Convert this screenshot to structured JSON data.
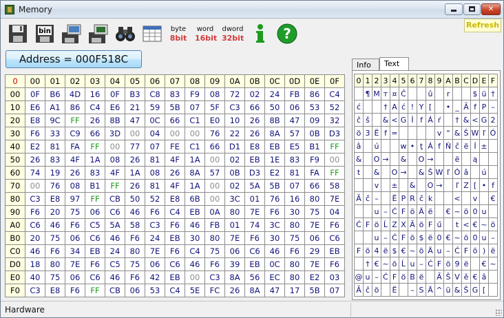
{
  "window": {
    "title": "Memory",
    "min_glyph": "",
    "max_glyph": "",
    "close_glyph": "✕"
  },
  "toolbar": {
    "buttons": [
      {
        "name": "save-icon"
      },
      {
        "name": "save-bin-icon",
        "label": "bin"
      },
      {
        "name": "save-computer-icon"
      },
      {
        "name": "save-chip-icon"
      },
      {
        "name": "find-binoculars-icon"
      },
      {
        "name": "calc-table-icon"
      },
      {
        "name": "byte-view",
        "top": "byte",
        "bottom": "8bit"
      },
      {
        "name": "word-view",
        "top": "word",
        "bottom": "16bit"
      },
      {
        "name": "dword-view",
        "top": "dword",
        "bottom": "32bit"
      },
      {
        "name": "info-icon",
        "glyph": "i"
      },
      {
        "name": "help-icon",
        "glyph": "?"
      }
    ],
    "refresh_label": "Refresh"
  },
  "address": {
    "label": "Address = 000F518C"
  },
  "hex": {
    "corner": "0",
    "cols": [
      "00",
      "01",
      "02",
      "03",
      "04",
      "05",
      "06",
      "07",
      "08",
      "09",
      "0A",
      "0B",
      "0C",
      "0D",
      "0E",
      "0F"
    ],
    "rows": [
      {
        "label": "00",
        "cells": [
          "0F",
          "B6",
          "4D",
          "16",
          "0F",
          "B3",
          "C8",
          "83",
          "F9",
          "08",
          "72",
          "02",
          "24",
          "FB",
          "86",
          "C4"
        ]
      },
      {
        "label": "10",
        "cells": [
          "E6",
          "A1",
          "86",
          "C4",
          "E6",
          "21",
          "59",
          "5B",
          "07",
          "5F",
          "C3",
          "66",
          "50",
          "06",
          "53",
          "52"
        ]
      },
      {
        "label": "20",
        "cells": [
          "E8",
          "9C",
          "FF",
          "26",
          "8B",
          "47",
          "0C",
          "66",
          "C1",
          "E0",
          "10",
          "26",
          "8B",
          "47",
          "09",
          "32"
        ]
      },
      {
        "label": "30",
        "cells": [
          "F6",
          "33",
          "C9",
          "66",
          "3D",
          "00",
          "04",
          "00",
          "00",
          "76",
          "22",
          "26",
          "8A",
          "57",
          "0B",
          "D3"
        ]
      },
      {
        "label": "40",
        "cells": [
          "E2",
          "81",
          "FA",
          "FF",
          "00",
          "77",
          "07",
          "FE",
          "C1",
          "66",
          "D1",
          "E8",
          "EB",
          "E5",
          "B1",
          "FF"
        ]
      },
      {
        "label": "50",
        "cells": [
          "26",
          "83",
          "4F",
          "1A",
          "08",
          "26",
          "81",
          "4F",
          "1A",
          "00",
          "02",
          "EB",
          "1E",
          "83",
          "F9",
          "00"
        ]
      },
      {
        "label": "60",
        "cells": [
          "74",
          "19",
          "26",
          "83",
          "4F",
          "1A",
          "08",
          "26",
          "8A",
          "57",
          "0B",
          "D3",
          "E2",
          "81",
          "FA",
          "FF"
        ]
      },
      {
        "label": "70",
        "cells": [
          "00",
          "76",
          "08",
          "B1",
          "FF",
          "26",
          "81",
          "4F",
          "1A",
          "00",
          "02",
          "5A",
          "5B",
          "07",
          "66",
          "58"
        ]
      },
      {
        "label": "80",
        "cells": [
          "C3",
          "E8",
          "97",
          "FF",
          "CB",
          "50",
          "52",
          "E8",
          "6B",
          "00",
          "3C",
          "01",
          "76",
          "16",
          "80",
          "7E"
        ]
      },
      {
        "label": "90",
        "cells": [
          "F6",
          "20",
          "75",
          "06",
          "C6",
          "46",
          "F6",
          "C4",
          "EB",
          "0A",
          "80",
          "7E",
          "F6",
          "30",
          "75",
          "04"
        ]
      },
      {
        "label": "A0",
        "cells": [
          "C6",
          "46",
          "F6",
          "C5",
          "5A",
          "58",
          "C3",
          "F6",
          "46",
          "FB",
          "01",
          "74",
          "3C",
          "80",
          "7E",
          "F6"
        ]
      },
      {
        "label": "B0",
        "cells": [
          "20",
          "75",
          "06",
          "C6",
          "46",
          "F6",
          "24",
          "EB",
          "30",
          "80",
          "7E",
          "F6",
          "30",
          "75",
          "06",
          "C6"
        ]
      },
      {
        "label": "C0",
        "cells": [
          "46",
          "F6",
          "34",
          "EB",
          "24",
          "80",
          "7E",
          "F6",
          "C4",
          "75",
          "06",
          "C6",
          "46",
          "F6",
          "29",
          "EB"
        ]
      },
      {
        "label": "D0",
        "cells": [
          "18",
          "80",
          "7E",
          "F6",
          "C5",
          "75",
          "06",
          "C6",
          "46",
          "F6",
          "39",
          "EB",
          "0C",
          "80",
          "7E",
          "F6"
        ]
      },
      {
        "label": "E0",
        "cells": [
          "40",
          "75",
          "06",
          "C6",
          "46",
          "F6",
          "42",
          "EB",
          "00",
          "C3",
          "8A",
          "56",
          "EC",
          "80",
          "E2",
          "03"
        ]
      },
      {
        "label": "F0",
        "cells": [
          "C3",
          "E8",
          "F6",
          "FF",
          "CB",
          "06",
          "53",
          "C4",
          "5E",
          "FC",
          "26",
          "8A",
          "47",
          "17",
          "5B",
          "07"
        ]
      }
    ]
  },
  "text_panel": {
    "tabs": [
      "Info",
      "Text"
    ],
    "cols": [
      "0",
      "1",
      "2",
      "3",
      "4",
      "5",
      "6",
      "7",
      "8",
      "9",
      "A",
      "B",
      "C",
      "D",
      "E",
      "F"
    ],
    "rows": [
      [
        "",
        "¶",
        "M",
        "т",
        "¤",
        "Č",
        "",
        "",
        "û",
        "",
        "r",
        "",
        "",
        "$",
        "ü",
        "†"
      ],
      [
        "ć",
        "",
        "",
        "†",
        "A",
        "ć",
        "!",
        "Y",
        "[",
        "",
        "•",
        "_",
        "Ă",
        "f",
        "P",
        "–"
      ],
      [
        "č",
        "š",
        "",
        "&",
        "<",
        "G",
        "Ì",
        "f",
        "Á",
        "ŕ",
        "",
        "†",
        "&",
        "<",
        "G",
        "2"
      ],
      [
        "ö",
        "3",
        "Ë",
        "f",
        "=",
        "",
        "",
        "",
        "",
        "v",
        "\"",
        "&",
        "Š",
        "W",
        "ľ",
        "Ó"
      ],
      [
        "â",
        "",
        "ú",
        "",
        "",
        "w",
        "•",
        "ţ",
        "Á",
        "f",
        "Ń",
        "č",
        "ë",
        "Í",
        "±",
        ""
      ],
      [
        "&",
        "",
        "O",
        "→",
        "",
        "&",
        "",
        "O",
        "→",
        "",
        "",
        "ë",
        "",
        "ą",
        "",
        ""
      ],
      [
        "t",
        "",
        "&",
        "",
        "O",
        "→",
        "",
        "&",
        "Š",
        "W",
        "ľ",
        "Ó",
        "â",
        "",
        "ú",
        ""
      ],
      [
        "",
        "",
        "v",
        "",
        "±",
        "",
        "&",
        "",
        "O",
        "→",
        "",
        "ľ",
        "Z",
        "[",
        "•",
        "f"
      ],
      [
        "Ă",
        "č",
        "–",
        "",
        "Ë",
        "P",
        "R",
        "č",
        "k",
        "",
        "",
        "<",
        "",
        "v",
        "",
        "€"
      ],
      [
        "",
        "",
        "u",
        "–",
        "Ć",
        "F",
        "ö",
        "Ä",
        "ë",
        "",
        "€",
        "~",
        "ö",
        "0",
        "u",
        ""
      ],
      [
        "Ć",
        "F",
        "ö",
        "Ĺ",
        "Z",
        "X",
        "Ă",
        "ö",
        "F",
        "ű",
        "",
        "t",
        "<",
        "€",
        "~",
        "ö"
      ],
      [
        "",
        "",
        "u",
        "–",
        "Ć",
        "F",
        "ö",
        "$",
        "ë",
        "0",
        "€",
        "~",
        "ö",
        "0",
        "u",
        "–"
      ],
      [
        "F",
        "ö",
        "4",
        "ë",
        "$",
        "€",
        "~",
        "ö",
        "Ä",
        "u",
        "–",
        "Ć",
        "F",
        "ö",
        ")",
        "ë"
      ],
      [
        "",
        "†",
        "€",
        "~",
        "ö",
        "Ĺ",
        "u",
        "–",
        "Ć",
        "F",
        "ö",
        "9",
        "ë",
        "",
        "€",
        "~"
      ],
      [
        "@",
        "u",
        "–",
        "Ć",
        "F",
        "ö",
        "B",
        "ë",
        "",
        "Ă",
        "Š",
        "V",
        "ě",
        "€",
        "â",
        ""
      ],
      [
        "Ă",
        "č",
        "ö",
        "",
        "Ë",
        "",
        "–",
        "S",
        "Ä",
        "^",
        "ü",
        "&",
        "Š",
        "G",
        "[",
        ""
      ]
    ]
  },
  "status": {
    "text": "Hardware"
  },
  "colors": {
    "hex_value": "#12127a",
    "ff_value": "#1a9a1a",
    "zero_value": "#8c8c8c",
    "header_bg": "#ffffe1",
    "corner": "#d00000",
    "refresh_text": "#c9b800"
  }
}
